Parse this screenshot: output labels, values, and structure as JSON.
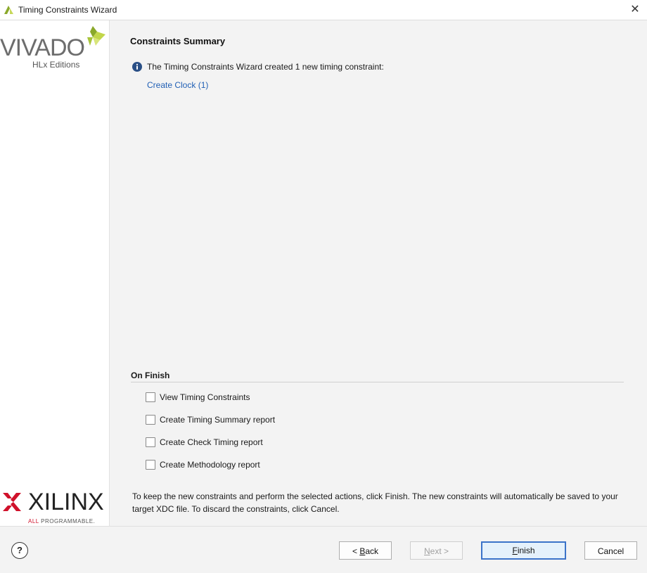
{
  "window": {
    "title": "Timing Constraints Wizard",
    "close_glyph": "✕"
  },
  "sidebar": {
    "vivado_brand": "VIVADO",
    "vivado_edition": "HLx Editions",
    "xilinx_brand": "XILINX",
    "xilinx_tagline_all": "ALL",
    "xilinx_tagline_rest": " PROGRAMMABLE."
  },
  "main": {
    "title": "Constraints Summary",
    "info_text": "The Timing Constraints Wizard created 1 new timing constraint:",
    "link_text": "Create Clock (1)",
    "on_finish": {
      "title": "On Finish",
      "options": [
        {
          "label": "View Timing Constraints",
          "checked": false
        },
        {
          "label": "Create Timing Summary report",
          "checked": false
        },
        {
          "label": "Create Check Timing report",
          "checked": false
        },
        {
          "label": "Create Methodology report",
          "checked": false
        }
      ]
    },
    "footer_note": "To keep the new constraints and perform the selected actions, click Finish. The new constraints will automatically be saved to your target XDC file. To discard the constraints, click Cancel."
  },
  "buttons": {
    "help": "?",
    "back_prefix": "< ",
    "back_mnemonic": "B",
    "back_rest": "ack",
    "next_mnemonic": "N",
    "next_rest": "ext >",
    "finish_mnemonic": "F",
    "finish_rest": "inish",
    "cancel": "Cancel"
  },
  "colors": {
    "link": "#2160b5",
    "primary_border": "#3b73c9",
    "xilinx_red": "#d0112b",
    "vivado_green": "#a8c43a"
  }
}
